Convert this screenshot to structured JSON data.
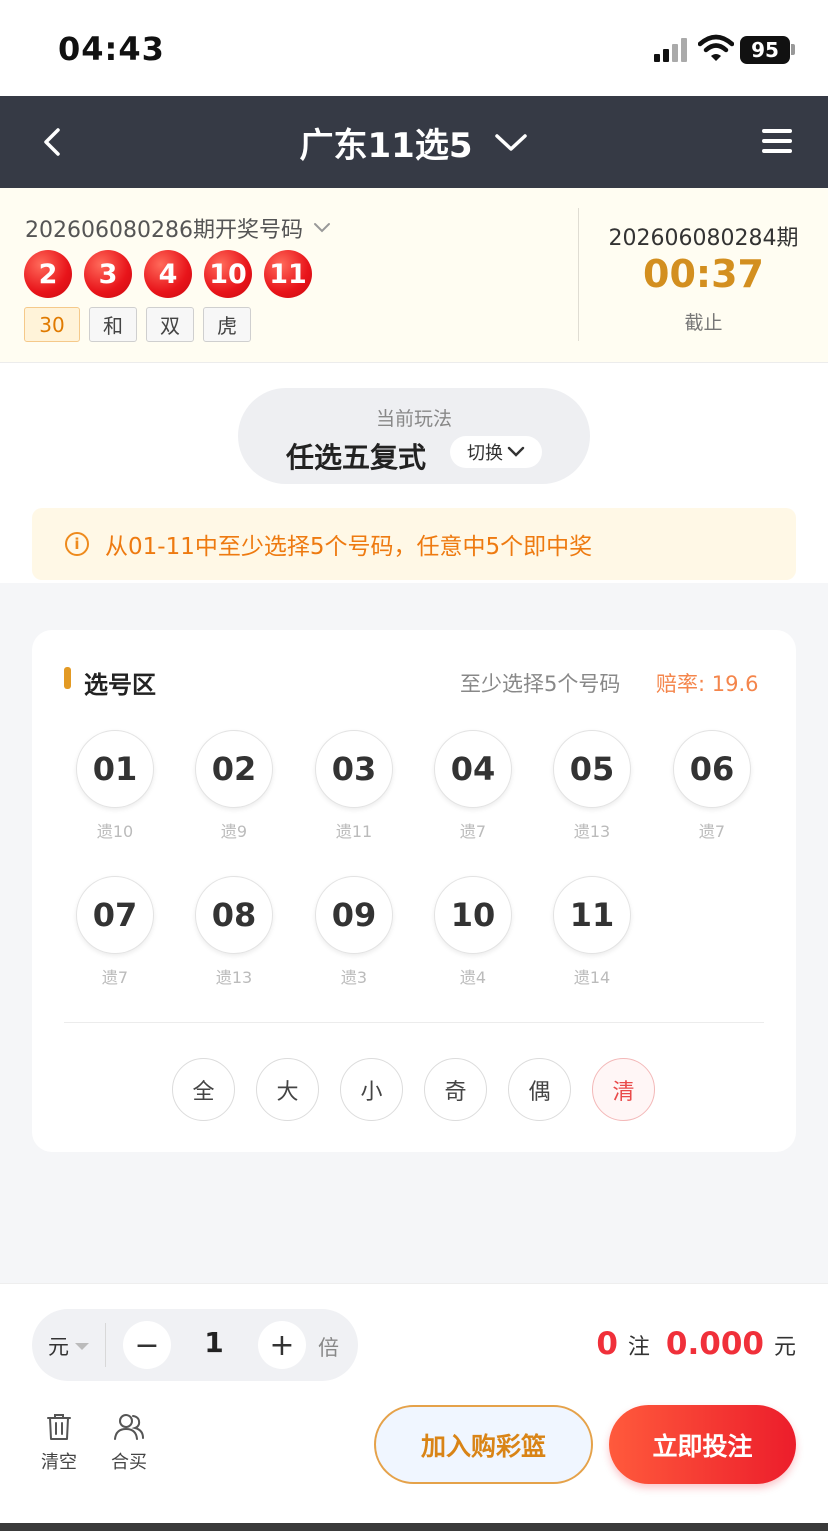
{
  "status": {
    "time": "04:43",
    "battery": "95"
  },
  "nav": {
    "title": "广东11选5"
  },
  "draw": {
    "issue_label": "202606080286期开奖号码",
    "balls": [
      "2",
      "3",
      "4",
      "10",
      "11"
    ],
    "tags": [
      "30",
      "和",
      "双",
      "虎"
    ],
    "next_issue": "202606080284期",
    "countdown": "00:37",
    "deadline_label": "截止"
  },
  "play": {
    "caption": "当前玩法",
    "name": "任选五复式",
    "switch_label": "切换",
    "tip": "从01-11中至少选择5个号码，任意中5个即中奖"
  },
  "card": {
    "title": "选号区",
    "hint": "至少选择5个号码",
    "odds": "赔率: 19.6",
    "numbers": [
      {
        "num": "01",
        "miss": "遗10"
      },
      {
        "num": "02",
        "miss": "遗9"
      },
      {
        "num": "03",
        "miss": "遗11"
      },
      {
        "num": "04",
        "miss": "遗7"
      },
      {
        "num": "05",
        "miss": "遗13"
      },
      {
        "num": "06",
        "miss": "遗7"
      },
      {
        "num": "07",
        "miss": "遗7"
      },
      {
        "num": "08",
        "miss": "遗13"
      },
      {
        "num": "09",
        "miss": "遗3"
      },
      {
        "num": "10",
        "miss": "遗4"
      },
      {
        "num": "11",
        "miss": "遗14"
      }
    ],
    "quick": [
      "全",
      "大",
      "小",
      "奇",
      "偶",
      "清"
    ]
  },
  "bottom": {
    "unit": "元",
    "minus": "−",
    "multiplier": "1",
    "plus": "+",
    "times": "倍",
    "count": "0",
    "count_unit": "注",
    "amount": "0.000",
    "amount_unit": "元",
    "clear_label": "清空",
    "group_label": "合买",
    "cart_label": "加入购彩篮",
    "bet_label": "立即投注"
  },
  "colors": {
    "nav_bg": "#363a45",
    "accent_red": "#f0303a",
    "accent_orange": "#d38f1f"
  }
}
